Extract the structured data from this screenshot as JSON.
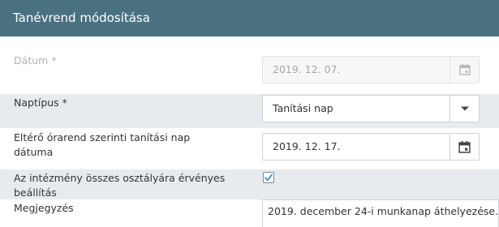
{
  "header": {
    "title": "Tanévrend módosítása"
  },
  "form": {
    "datum": {
      "label": "Dátum *",
      "value": "2019. 12. 07."
    },
    "naptipus": {
      "label": "Naptípus *",
      "value": "Tanítási nap"
    },
    "elteroOrarend": {
      "label_line1": "Eltérő órarend szerinti tanítási nap",
      "label_line2": "dátuma",
      "value": "2019. 12. 17."
    },
    "osszesOsztaly": {
      "label_line1": "Az intézmény összes osztályára érvényes",
      "label_line2": "beállítás",
      "checked": true
    },
    "megjegyzes": {
      "label": "Megjegyzés",
      "value": "2019. december 24-i munkanap áthelyezése."
    }
  },
  "icons": {
    "calendar": "calendar-icon",
    "dropdown": "chevron-down-icon",
    "check": "check-icon"
  },
  "colors": {
    "header_bg": "#4a7180",
    "row_shaded": "#e8ebee",
    "checkbox_check": "#3b8fd6"
  }
}
